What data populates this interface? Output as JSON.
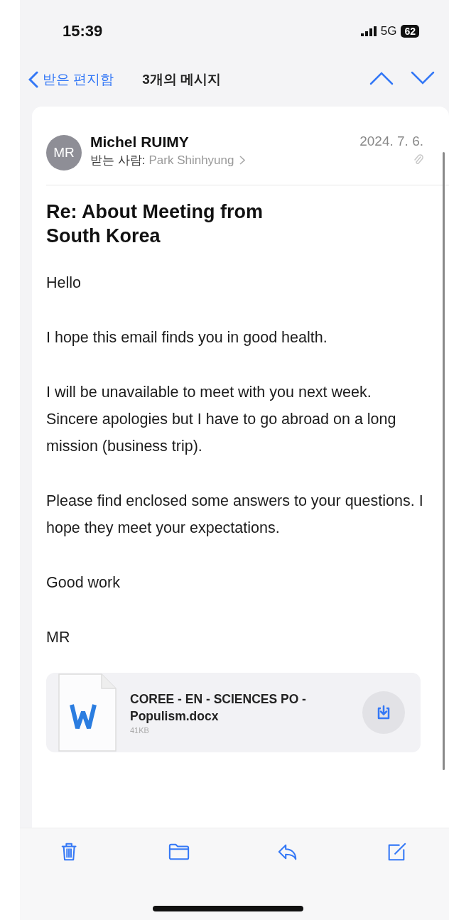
{
  "status_bar": {
    "time": "15:39",
    "network": "5G",
    "battery": "62"
  },
  "nav": {
    "back_label": "받은 편지함",
    "title": "3개의 메시지"
  },
  "message": {
    "avatar_initials": "MR",
    "sender": "Michel RUIMY",
    "date": "2024. 7. 6.",
    "to_label": "받는 사람:",
    "recipient": "Park Shinhyung",
    "has_attachment": true,
    "subject": "Re: About Meeting from South Korea",
    "body": [
      "Hello",
      "I hope this email finds you in good health.",
      "I will be unavailable to meet with you next week. Sincere apologies but I have to go abroad on a long mission (business trip).",
      "Please find enclosed some answers to your questions. I hope they meet your expectations.",
      "Good work",
      "MR"
    ],
    "attachment": {
      "file_name": "COREE - EN - SCIENCES PO - Populism.docx",
      "size": "41KB"
    }
  }
}
